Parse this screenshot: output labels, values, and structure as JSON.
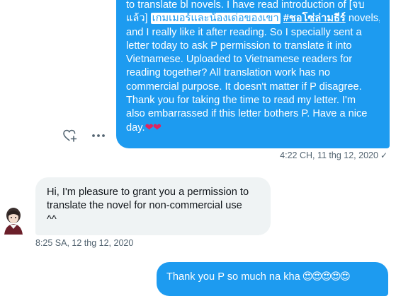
{
  "messages": {
    "outgoing_long": {
      "lines": [
        "to translate bl novels. I have read introduction of [จบ",
        "novels,",
        "and I really like it after reading. So I specially sent a",
        "letter today to ask P permission to translate it into",
        "Vietnamese. Uploaded to Vietnamese readers for",
        "reading together? All translation work has no",
        "commercial purpose. It doesn't matter if P disagree.",
        "Thank you for taking the time to read my letter. I'm",
        "also embarrassed if this letter bothers P. Have a nice",
        "day."
      ],
      "line2_prefix": "แล้ว]",
      "highlight_text": "เกมเมอร์และน้องเด่อของเขา",
      "hashtag_text": "#ชอโซ่ล่ามธีร์",
      "hearts": "❤❤",
      "timestamp": "4:22 CH, 11 thg 12, 2020",
      "status_icon": "check-icon"
    },
    "incoming": {
      "lines": [
        "Hi, I'm pleasure to grant you a permission to",
        "translate the novel for non-commercial use",
        "^^"
      ],
      "timestamp": "8:25 SA, 12 thg 12, 2020"
    },
    "outgoing_short": {
      "text": "Thank you P so much na kha",
      "emojis": "😍😍😍😍😍"
    }
  },
  "actions": {
    "react_icon": "heart-plus-icon",
    "more_icon": "more-horizontal-icon"
  },
  "colors": {
    "accent": "#1d9bf0",
    "incoming_bubble": "#eff3f4",
    "meta_text": "#536471"
  }
}
